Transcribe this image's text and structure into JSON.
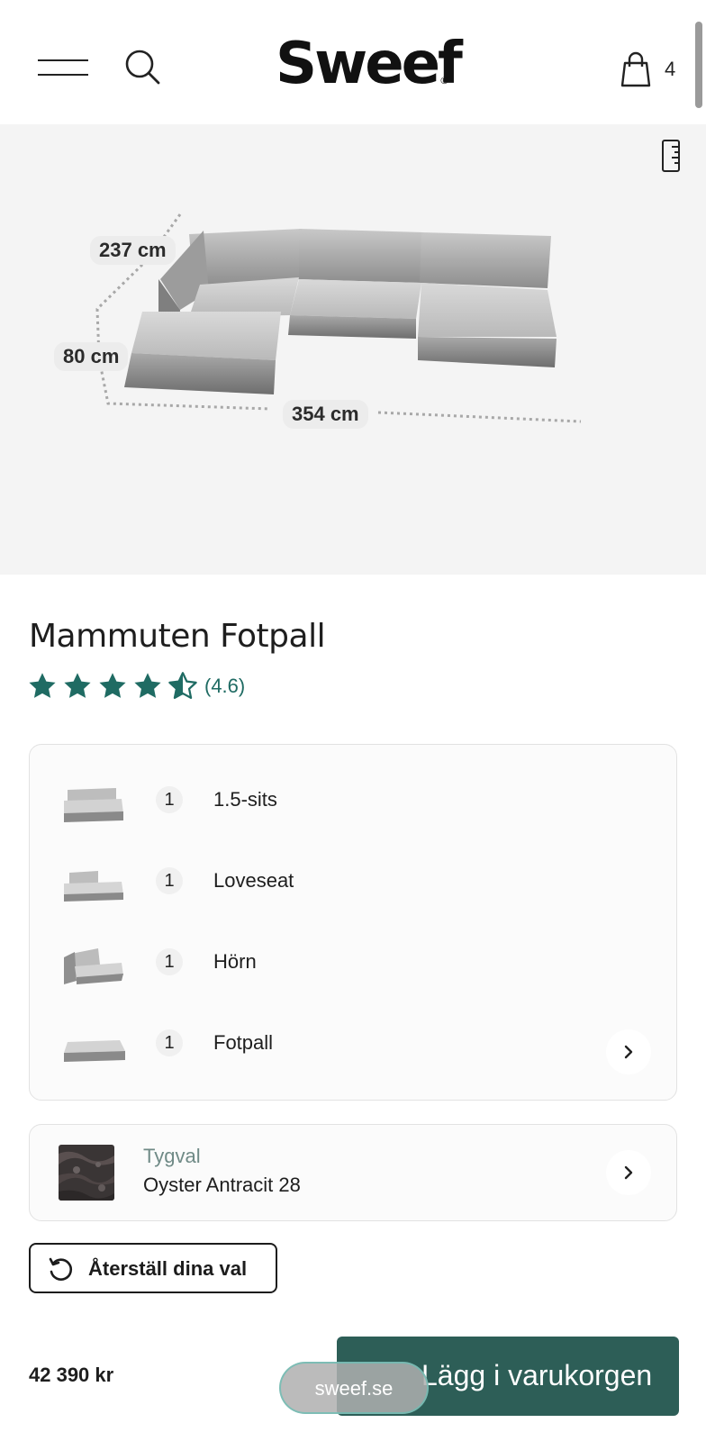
{
  "header": {
    "logo": "Sweef",
    "logo_mark": "®",
    "cart_count": "4",
    "icons": [
      "menu-icon",
      "search-icon",
      "shopping-bag-icon"
    ]
  },
  "hero": {
    "dimensions": {
      "depth": "237 cm",
      "height": "80 cm",
      "width": "354 cm"
    },
    "icons": [
      "ruler-icon"
    ]
  },
  "product": {
    "title": "Mammuten Fotpall",
    "rating_text": "(4.6)",
    "rating_value": 4.6,
    "rating_max": 5,
    "rating_color": "#1f6b63"
  },
  "modules": [
    {
      "qty": "1",
      "name": "1.5-sits"
    },
    {
      "qty": "1",
      "name": "Loveseat"
    },
    {
      "qty": "1",
      "name": "Hörn"
    },
    {
      "qty": "1",
      "name": "Fotpall"
    }
  ],
  "fabric": {
    "label": "Tygval",
    "value": "Oyster Antracit 28"
  },
  "reset_button": {
    "label": "Återställ dina val"
  },
  "cart_bar": {
    "price": "42 390 kr",
    "add_label": "Lägg i varukorgen",
    "accent": "#2d5e57"
  },
  "browser": {
    "url": "sweef.se"
  }
}
